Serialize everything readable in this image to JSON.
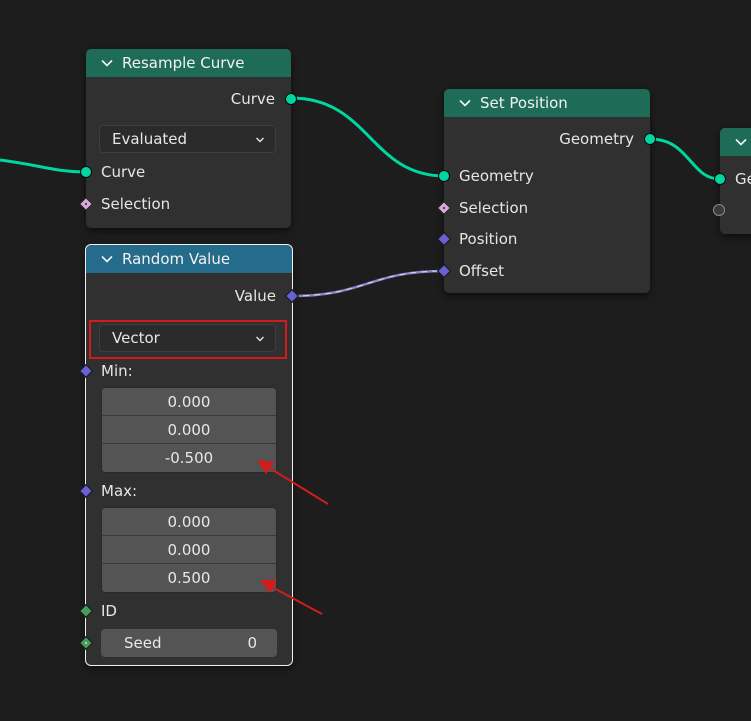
{
  "colors": {
    "background": "#1d1d1d",
    "node_body": "#303030",
    "geometry_header": "#1e6c58",
    "utility_header": "#256c8c",
    "geometry_socket": "#00d7a0",
    "vector_socket": "#6a61d0",
    "boolean_socket": "#d8a8d8",
    "integer_socket": "#4a9a5a",
    "annotation_red": "#d21c1c"
  },
  "resample_curve": {
    "title": "Resample Curve",
    "output_curve": "Curve",
    "mode": "Evaluated",
    "input_curve": "Curve",
    "input_selection": "Selection"
  },
  "set_position": {
    "title": "Set Position",
    "output_geometry": "Geometry",
    "input_geometry": "Geometry",
    "input_selection": "Selection",
    "input_position": "Position",
    "input_offset": "Offset"
  },
  "partial_node": {
    "input_label": "Ge"
  },
  "random_value": {
    "title": "Random Value",
    "output_value": "Value",
    "data_type": "Vector",
    "min_label": "Min:",
    "min_values": [
      "0.000",
      "0.000",
      "-0.500"
    ],
    "max_label": "Max:",
    "max_values": [
      "0.000",
      "0.000",
      "0.500"
    ],
    "id_label": "ID",
    "seed_label": "Seed",
    "seed_value": "0"
  }
}
